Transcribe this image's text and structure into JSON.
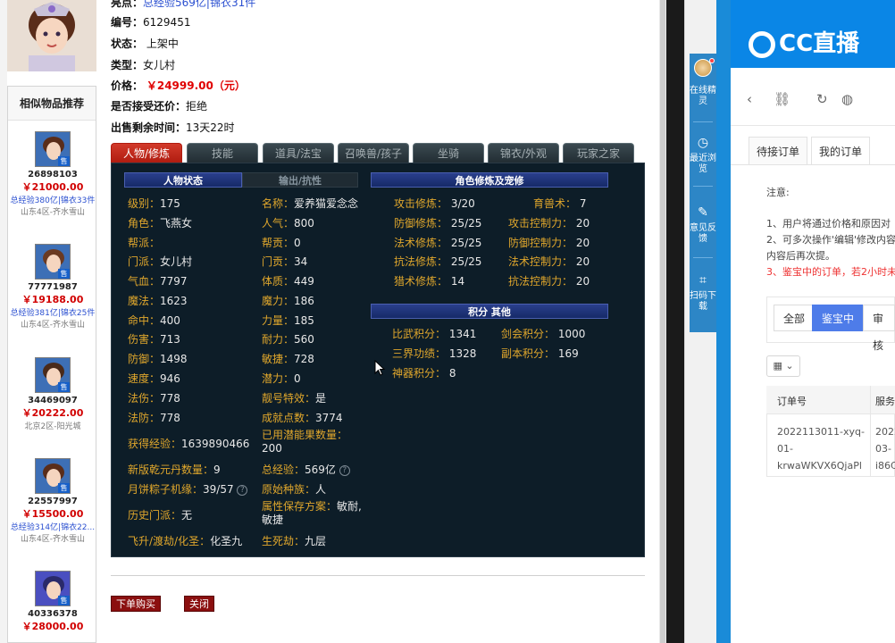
{
  "item_info": {
    "highlight_label": "亮点：",
    "highlight_value": "总经验569亿|锦衣31件",
    "id_label": "编号：",
    "id_value": "6129451",
    "status_label": "状态：",
    "status_value": "上架中",
    "type_label": "类型：",
    "type_value": "女儿村",
    "price_label": "价格：",
    "price_value": "￥24999.00（元）",
    "counter_label": "是否接受还价：",
    "counter_value": "拒绝",
    "remain_label": "出售剩余时间：",
    "remain_value": "13天22时"
  },
  "similar": {
    "title": "相似物品推荐",
    "items": [
      {
        "id": "26898103",
        "price": "￥21000.00",
        "extra": "总经验380亿|锦衣33件",
        "server": "山东4区-齐水雪山",
        "sell": "售"
      },
      {
        "id": "77771987",
        "price": "￥19188.00",
        "extra": "总经验381亿|锦衣25件",
        "server": "山东4区-齐水雪山",
        "sell": "售"
      },
      {
        "id": "34469097",
        "price": "￥20222.00",
        "extra": "",
        "server": "北京2区-阳光城",
        "sell": "售"
      },
      {
        "id": "22557997",
        "price": "￥15500.00",
        "extra": "总经验314亿|锦衣22...",
        "server": "山东4区-齐水雪山",
        "sell": "售"
      },
      {
        "id": "40336378",
        "price": "￥28000.00",
        "extra": "",
        "server": "",
        "sell": "售"
      }
    ]
  },
  "tabs": [
    "人物/修炼",
    "技能",
    "道具/法宝",
    "召唤兽/孩子",
    "坐骑",
    "锦衣/外观",
    "玩家之家"
  ],
  "panel": {
    "sub_tab_active": "人物状态",
    "sub_tab_inactive": "输出/抗性",
    "cultivation_header": "角色修炼及宠修",
    "points_header": "积分 其他",
    "left_col": [
      {
        "label": "级别：",
        "value": "175"
      },
      {
        "label": "角色：",
        "value": "飞燕女"
      },
      {
        "label": "帮派：",
        "value": ""
      },
      {
        "label": "门派：",
        "value": "女儿村"
      },
      {
        "label": "气血：",
        "value": "7797"
      },
      {
        "label": "魔法：",
        "value": "1623"
      },
      {
        "label": "命中：",
        "value": "400"
      },
      {
        "label": "伤害：",
        "value": "713"
      },
      {
        "label": "防御：",
        "value": "1498"
      },
      {
        "label": "速度：",
        "value": "946"
      },
      {
        "label": "法伤：",
        "value": "778"
      },
      {
        "label": "法防：",
        "value": "778"
      }
    ],
    "mid_col": [
      {
        "label": "名称：",
        "value": "爱养猫爱念念"
      },
      {
        "label": "人气：",
        "value": "800"
      },
      {
        "label": "帮贡：",
        "value": "0"
      },
      {
        "label": "门贡：",
        "value": "34"
      },
      {
        "label": "体质：",
        "value": "449"
      },
      {
        "label": "魔力：",
        "value": "186"
      },
      {
        "label": "力量：",
        "value": "185"
      },
      {
        "label": "耐力：",
        "value": "560"
      },
      {
        "label": "敏捷：",
        "value": "728"
      },
      {
        "label": "潜力：",
        "value": "0"
      },
      {
        "label": "靓号特效：",
        "value": "是"
      },
      {
        "label": "成就点数：",
        "value": "3774"
      }
    ],
    "extra_left": [
      {
        "label": "获得经验：",
        "value": "1639890466"
      },
      {
        "label": "新版乾元丹数量：",
        "value": "9"
      },
      {
        "label": "月饼粽子机缘：",
        "value": "39/57"
      },
      {
        "label": "历史门派：",
        "value": "无"
      },
      {
        "label": "飞升/渡劫/化圣：",
        "value": "化圣九"
      }
    ],
    "extra_mid": [
      {
        "label": "已用潜能果数量：",
        "value": "200"
      },
      {
        "label": "总经验：",
        "value": "569亿"
      },
      {
        "label": "原始种族：",
        "value": "人"
      },
      {
        "label": "属性保存方案：",
        "value": "敏耐,敏捷"
      },
      {
        "label": "生死劫：",
        "value": "九层"
      }
    ],
    "cultivation": [
      {
        "label": "攻击修炼：",
        "value": "3/20",
        "label2": "育兽术：",
        "value2": "7"
      },
      {
        "label": "防御修炼：",
        "value": "25/25",
        "label2": "攻击控制力：",
        "value2": "20"
      },
      {
        "label": "法术修炼：",
        "value": "25/25",
        "label2": "防御控制力：",
        "value2": "20"
      },
      {
        "label": "抗法修炼：",
        "value": "25/25",
        "label2": "法术控制力：",
        "value2": "20"
      },
      {
        "label": "猎术修炼：",
        "value": "14",
        "label2": "抗法控制力：",
        "value2": "20"
      }
    ],
    "points": [
      {
        "label": "比武积分：",
        "value": "1341",
        "label2": "剑会积分：",
        "value2": "1000"
      },
      {
        "label": "三界功绩：",
        "value": "1328",
        "label2": "副本积分：",
        "value2": "169"
      },
      {
        "label": "神器积分：",
        "value": "8",
        "label2": "",
        "value2": ""
      }
    ]
  },
  "actions": {
    "buy": "下单购买",
    "close": "关闭"
  },
  "toolbar": {
    "online": "在线精灵",
    "recent": "最近浏览",
    "feedback": "意见反馈",
    "scan": "扫码下载"
  },
  "right": {
    "logo": "CC直播",
    "tab_pending": "待接订单",
    "tab_mine": "我的订单",
    "notice_title": "注意:",
    "notice_1": "1、用户将通过价格和原因对",
    "notice_2": "2、可多次操作'编辑'修改内容",
    "notice_3": "内容后再次提。",
    "notice_4": "3、鉴宝中的订单，若2小时未",
    "filter_all": "全部",
    "filter_appraising": "鉴宝中",
    "filter_review": "审核",
    "col_order": "订单号",
    "col_service": "服务",
    "order_no_1": "2022113011-xyq-",
    "order_no_2": "01-",
    "order_no_3": "krwaWKVX6QjaPl",
    "service_1": "2022",
    "service_2": "03-",
    "service_3": "i86C"
  },
  "colors": {
    "accent_red": "#e00000",
    "panel_bg": "#0d1d28",
    "label_gold": "#e0a72c",
    "cc_blue": "#0a86e6",
    "filter_active": "#4e7ce9"
  }
}
